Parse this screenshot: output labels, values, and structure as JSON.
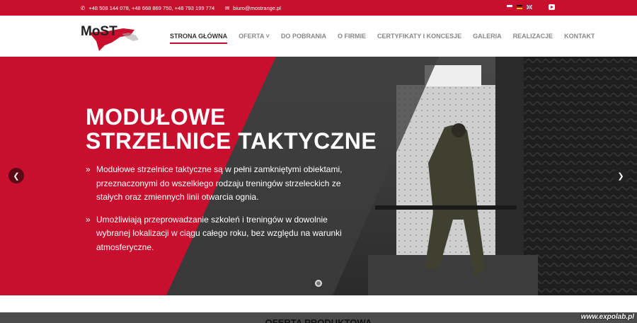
{
  "topbar": {
    "phones": "+48 508 144 078, +48 668 869 750, +48 793 199 774",
    "email": "biuro@mostrange.pl"
  },
  "logo": {
    "text": "MoST"
  },
  "nav": [
    {
      "label": "STRONA GŁÓWNA",
      "active": true
    },
    {
      "label": "OFERTA"
    },
    {
      "label": "DO POBRANIA"
    },
    {
      "label": "O FIRMIE"
    },
    {
      "label": "CERTYFIKATY I KONCESJE"
    },
    {
      "label": "GALERIA"
    },
    {
      "label": "REALIZACJE"
    },
    {
      "label": "KONTAKT"
    }
  ],
  "hero": {
    "title_line1": "MODUŁOWE",
    "title_line2": "STRZELNICE TAKTYCZNE",
    "bullets": [
      "Modułowe strzelnice taktyczne są w pełni zamkniętymi obiektami, przeznaczonymi do wszelkiego rodzaju treningów strzeleckich ze stałych oraz zmiennych linii otwarcia ognia.",
      "Umożliwiają przeprowadzanie szkoleń i treningów w dowolnie wybranej lokalizacji w ciągu całego roku, bez względu na warunki atmosferyczne."
    ]
  },
  "section": {
    "title": "OFERTA PRODUKTOWA"
  },
  "watermark": "www.expolab.pl",
  "colors": {
    "accent": "#c8102e"
  }
}
